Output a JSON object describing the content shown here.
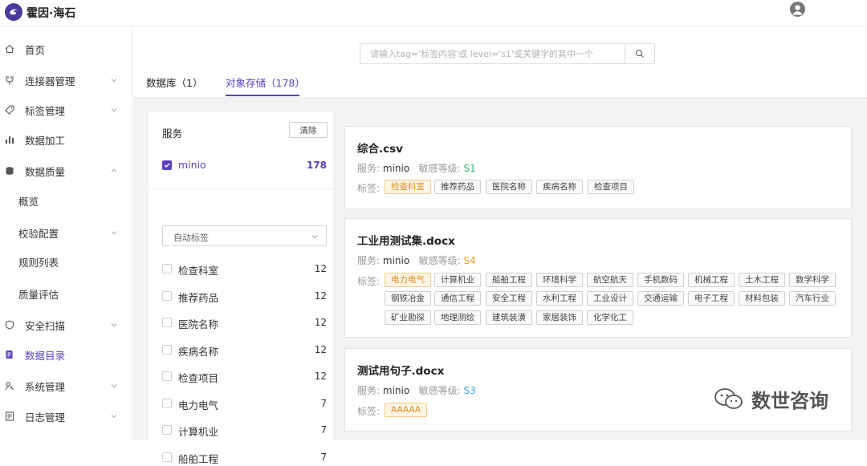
{
  "app": {
    "title": "霍因·海石"
  },
  "sidebar": {
    "items": [
      {
        "label": "首页",
        "icon": "home-icon"
      },
      {
        "label": "连接器管理",
        "icon": "connector-icon"
      },
      {
        "label": "标签管理",
        "icon": "tag-icon"
      },
      {
        "label": "数据加工",
        "icon": "chart-icon"
      },
      {
        "label": "数据质量",
        "icon": "quality-icon"
      },
      {
        "label": "概览"
      },
      {
        "label": "校验配置"
      },
      {
        "label": "规则列表"
      },
      {
        "label": "质量评估"
      },
      {
        "label": "安全扫描",
        "icon": "shield-icon"
      },
      {
        "label": "数据目录",
        "icon": "catalog-icon"
      },
      {
        "label": "系统管理",
        "icon": "system-icon"
      },
      {
        "label": "日志管理",
        "icon": "log-icon"
      }
    ]
  },
  "search": {
    "placeholder": "请输入tag='标签内容'或 level='s1'或关键字的其中一个"
  },
  "tabs": [
    {
      "label": "数据库（1）"
    },
    {
      "label": "对象存储（178）"
    }
  ],
  "filter": {
    "title": "服务",
    "clear_label": "清除",
    "service": {
      "label": "minio",
      "count": "178"
    },
    "select_value": "自动标签",
    "items": [
      {
        "label": "检查科室",
        "count": "12"
      },
      {
        "label": "推荐药品",
        "count": "12"
      },
      {
        "label": "医院名称",
        "count": "12"
      },
      {
        "label": "疾病名称",
        "count": "12"
      },
      {
        "label": "检查项目",
        "count": "12"
      },
      {
        "label": "电力电气",
        "count": "7"
      },
      {
        "label": "计算机业",
        "count": "7"
      },
      {
        "label": "船舶工程",
        "count": "7"
      }
    ]
  },
  "cards": [
    {
      "title": "综合.csv",
      "service_label": "服务:",
      "service": "minio",
      "level_label": "敏感等级:",
      "level": "S1",
      "level_color": "#2bb673",
      "tags_label": "标签:",
      "tags": [
        "检查科室",
        "推荐药品",
        "医院名称",
        "疾病名称",
        "检查项目"
      ]
    },
    {
      "title": "工业用测试集.docx",
      "service_label": "服务:",
      "service": "minio",
      "level_label": "敏感等级:",
      "level": "S4",
      "level_color": "#f0a020",
      "tags_label": "标签:",
      "tags": [
        "电力电气",
        "计算机业",
        "船舶工程",
        "环境科学",
        "航空航天",
        "手机数码",
        "机械工程",
        "土木工程",
        "数学科学",
        "钢铁冶金",
        "通信工程",
        "安全工程",
        "水利工程",
        "工业设计",
        "交通运输",
        "电子工程",
        "材料包装",
        "汽车行业",
        "矿业勘探",
        "地理测绘",
        "建筑装潢",
        "家居装饰",
        "化学化工"
      ]
    },
    {
      "title": "测试用句子.docx",
      "service_label": "服务:",
      "service": "minio",
      "level_label": "敏感等级:",
      "level": "S3",
      "level_color": "#3aa3e3",
      "tags_label": "标签:",
      "tags": [
        "AAAAA"
      ]
    }
  ],
  "watermark": {
    "text": "数世咨询"
  },
  "colors": {
    "accent": "#5b3fc4"
  }
}
